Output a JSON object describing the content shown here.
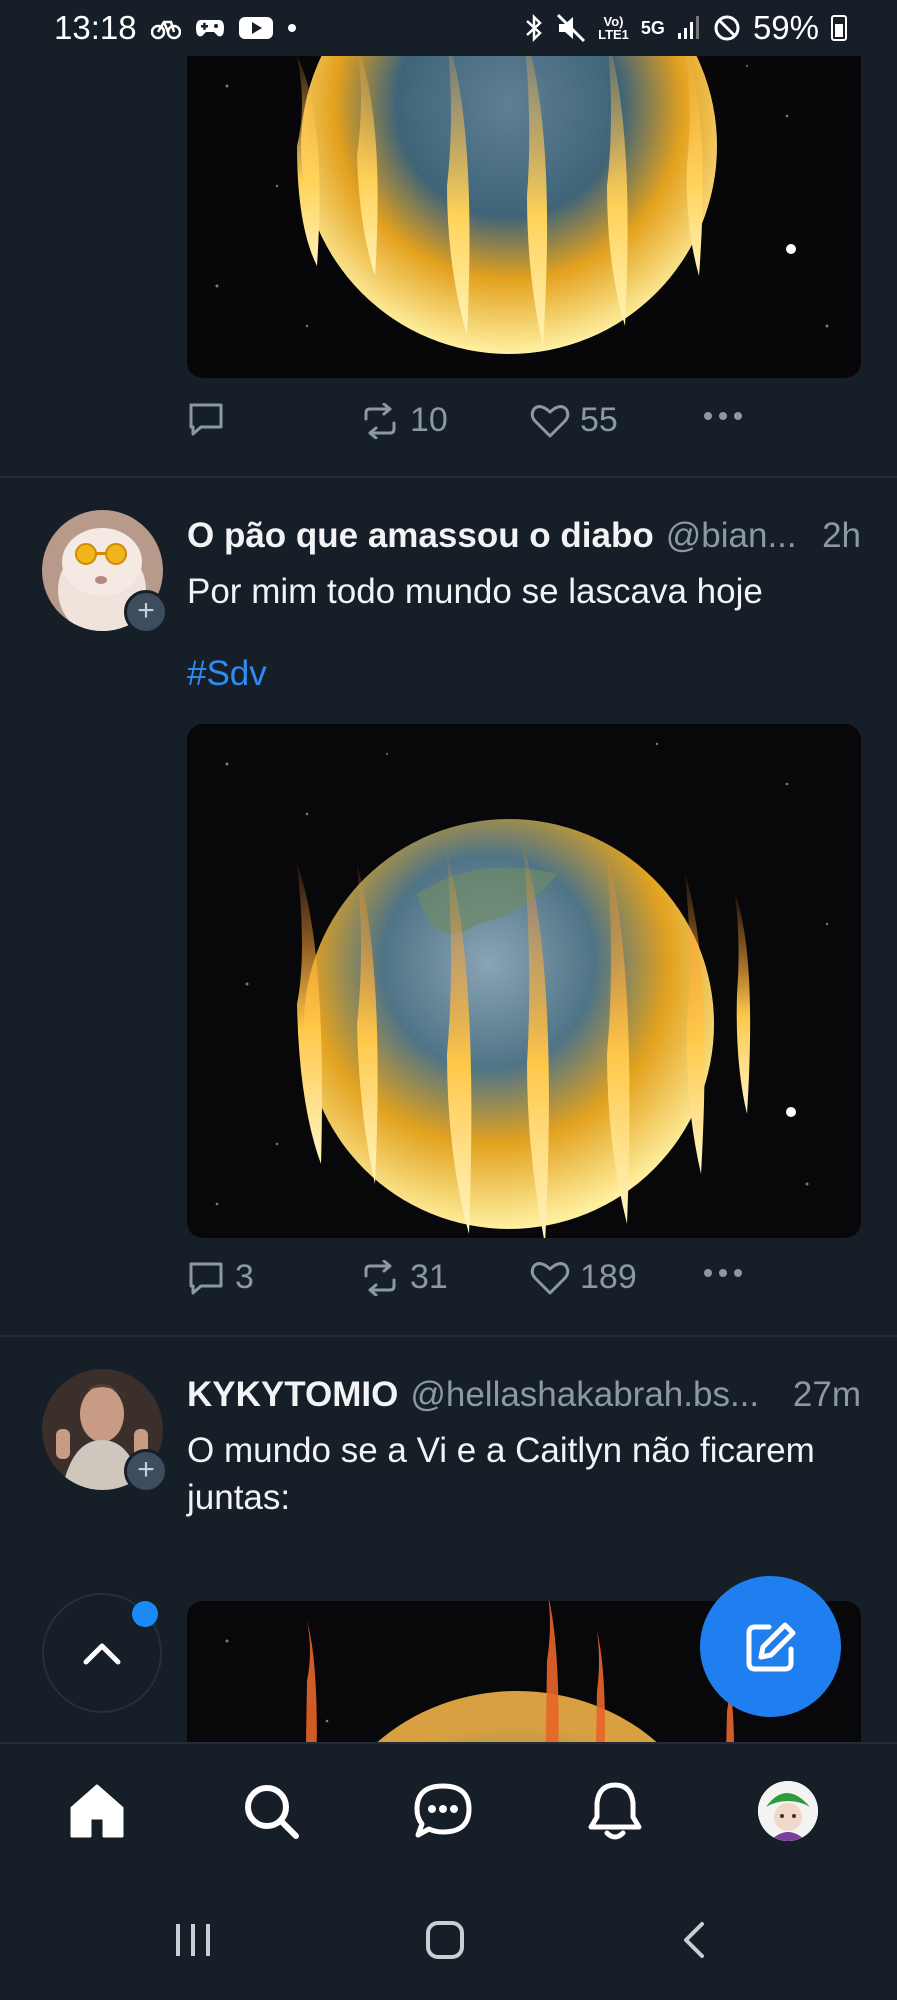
{
  "status_bar": {
    "time": "13:18",
    "volte": "Vo)\nLTE1",
    "network": "5G",
    "battery": "59%",
    "icons": [
      "bike-icon",
      "game-controller-icon",
      "youtube-icon",
      "dot-icon",
      "bluetooth-icon",
      "mute-icon",
      "signal-icon",
      "dnd-icon",
      "battery-icon"
    ]
  },
  "posts": [
    {
      "media_alt": "burning earth image",
      "actions": {
        "reply_count": "",
        "repost_count": "10",
        "like_count": "55"
      }
    },
    {
      "display_name": "O pão que amassou o diabo",
      "handle": "@bian...",
      "time": "2h",
      "text": "Por mim todo mundo se lascava hoje",
      "hashtag": "#Sdv",
      "actions": {
        "reply_count": "3",
        "repost_count": "31",
        "like_count": "189"
      }
    },
    {
      "display_name": "KYKYTOMIO",
      "handle": "@hellashakabrah.bs...",
      "time": "27m",
      "text": "O mundo se a Vi e a Caitlyn não ficarem juntas:"
    }
  ],
  "nav": {
    "tabs": [
      "home-icon",
      "search-icon",
      "chat-icon",
      "bell-icon",
      "profile-avatar"
    ]
  },
  "colors": {
    "background": "#161e27",
    "accent": "#1f7ff0",
    "hashtag": "#2f8cf2",
    "muted": "#8b98a5"
  }
}
